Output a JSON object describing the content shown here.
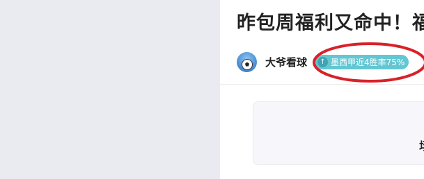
{
  "article": {
    "title": "昨包周福利又命中！福"
  },
  "author": {
    "name": "大爷看球",
    "avatar_icon": "soccer-ball-avatar"
  },
  "badge": {
    "icon": "arrow-up-icon",
    "glyph": "↑",
    "text": "墨西甲近4胜率75%",
    "color": "#63c7d3"
  },
  "card": {
    "glyph": "场"
  },
  "annotation": {
    "color": "#d9212a"
  }
}
